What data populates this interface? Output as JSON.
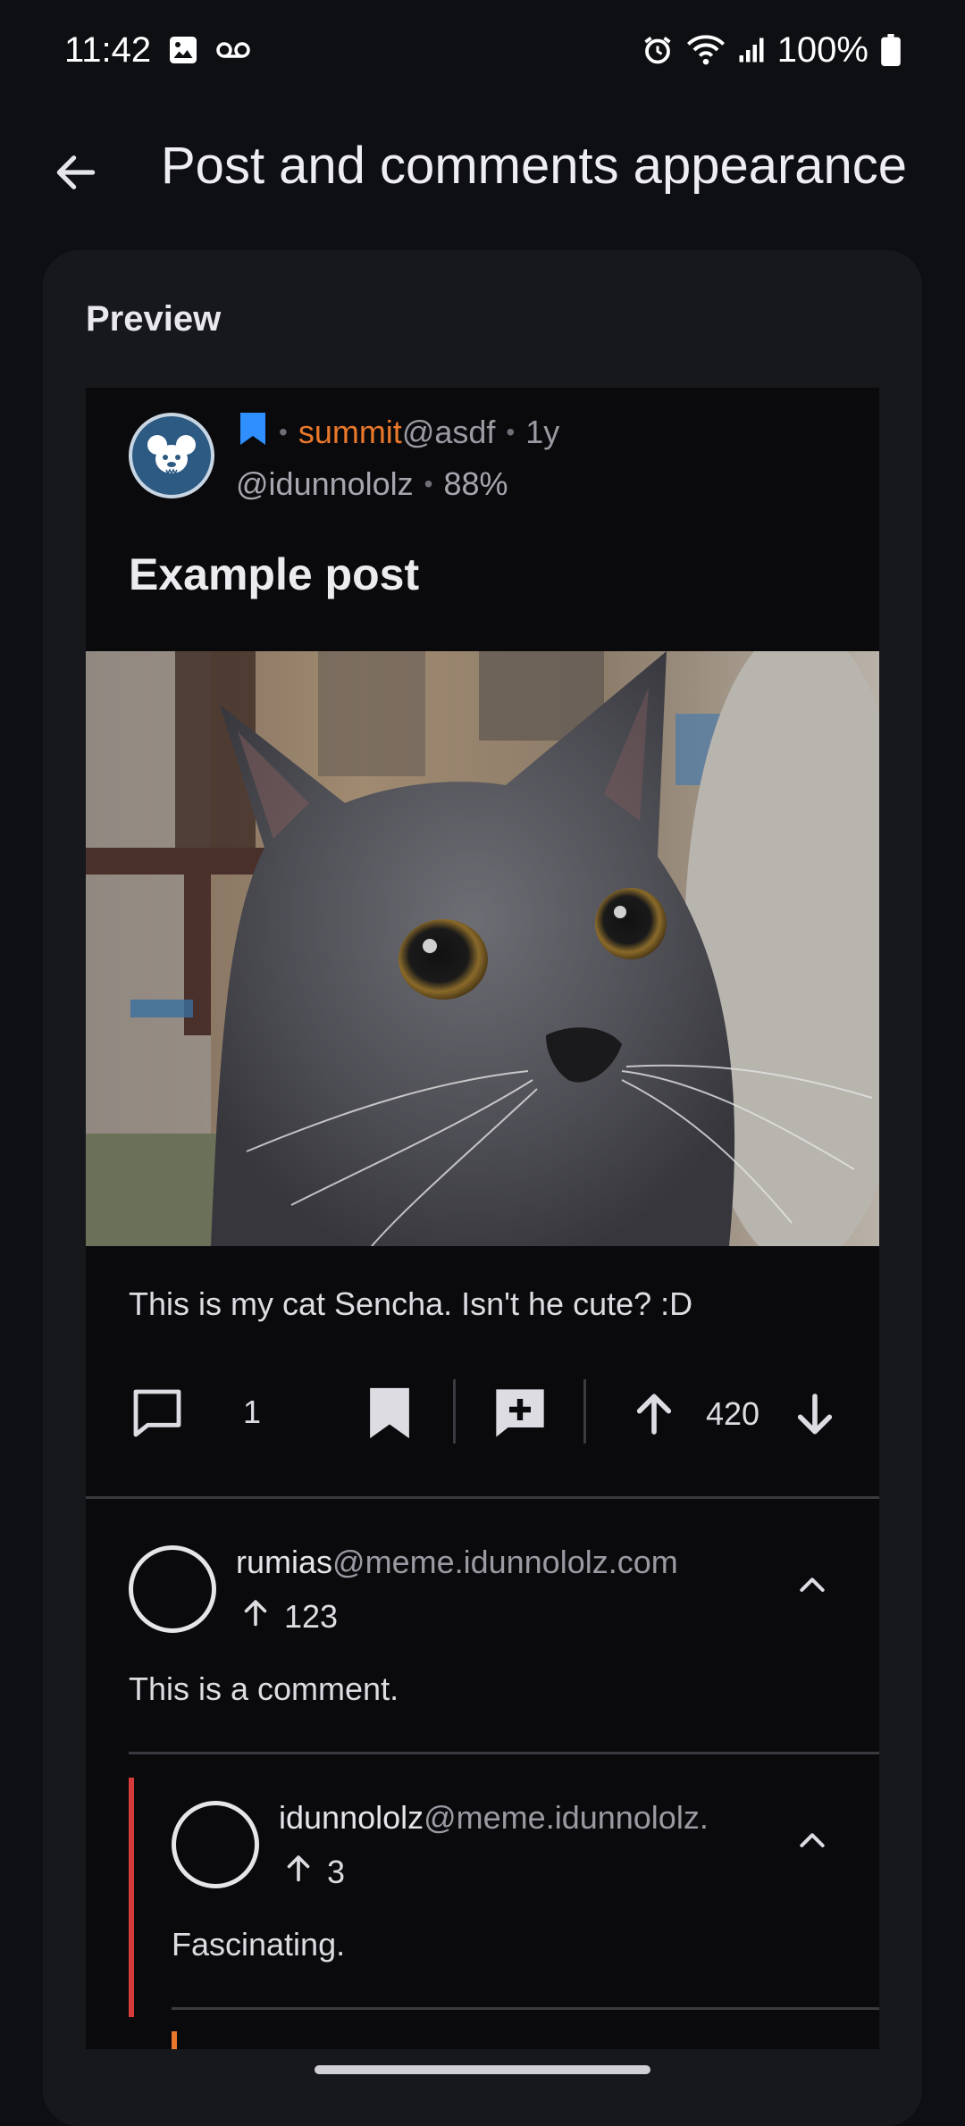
{
  "status_bar": {
    "time": "11:42",
    "battery": "100%",
    "left_icons": [
      "gallery-icon",
      "voicemail-icon"
    ],
    "right_icons": [
      "alarm-icon",
      "wifi-icon",
      "signal-icon",
      "battery-icon"
    ]
  },
  "app_bar": {
    "title": "Post and comments appearance",
    "back_icon": "arrow-back-icon"
  },
  "preview": {
    "label": "Preview",
    "post": {
      "community": "summit",
      "instance": "@asdf",
      "age": "1y",
      "author": "@idunnololz",
      "upvote_ratio": "88%",
      "title": "Example post",
      "body": "This is my cat Sencha. Isn't he cute? :D",
      "comment_count": "1",
      "score": "420",
      "image_subject": "gray cat photo"
    },
    "comments": [
      {
        "author": "rumias",
        "instance": "@meme.idunnololz.com",
        "score": "123",
        "body": "This is a comment."
      },
      {
        "author": "idunnololz",
        "instance": "@meme.idunnololz.",
        "score": "3",
        "body": "Fascinating."
      }
    ]
  },
  "colors": {
    "background": "#0e0f13",
    "card": "#17181c",
    "community_accent": "#e8782a",
    "bookmark_blue": "#2f8fff",
    "thread_red": "#d63a3a",
    "thread_orange": "#e8782a"
  }
}
